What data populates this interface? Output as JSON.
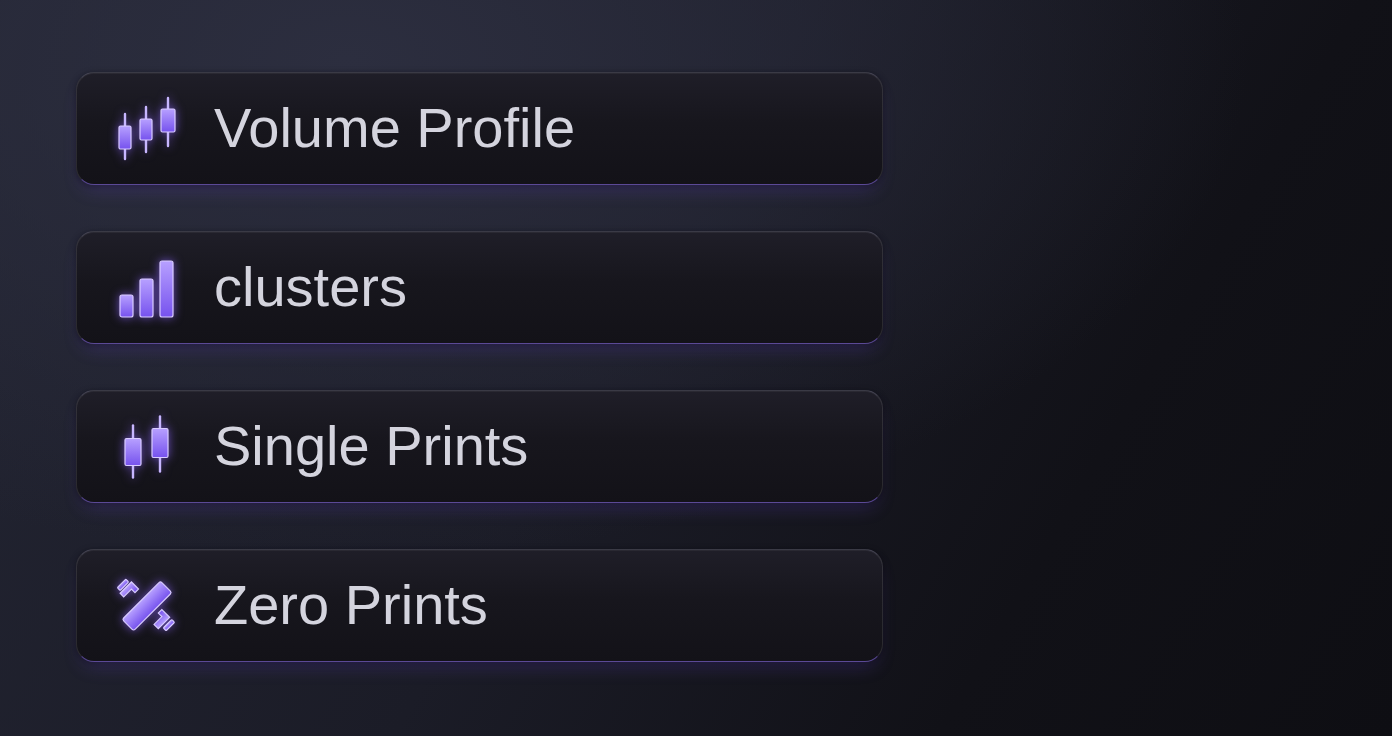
{
  "items": [
    {
      "label": "Volume Profile",
      "kind": "candles3"
    },
    {
      "label": "clusters",
      "kind": "bars"
    },
    {
      "label": "Single Prints",
      "kind": "candles2"
    },
    {
      "label": "Zero Prints",
      "kind": "cross"
    }
  ]
}
